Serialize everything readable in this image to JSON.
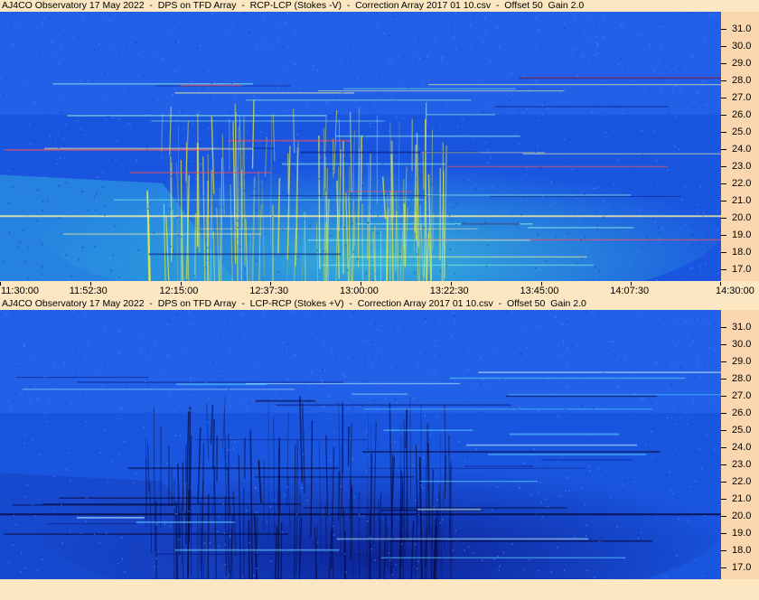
{
  "chart_data": [
    {
      "type": "heatmap",
      "title": "AJ4CO Observatory 17 May 2022  -  DPS on TFD Array  -  RCP-LCP (Stokes -V)  -  Correction Array 2017 01 10.csv  -  Offset 50  Gain 2.0",
      "y_ticks": [
        "31.0",
        "30.0",
        "29.0",
        "28.0",
        "27.0",
        "26.0",
        "25.0",
        "24.0",
        "23.0",
        "22.0",
        "21.0",
        "20.0",
        "19.0",
        "18.0",
        "17.0"
      ],
      "x_ticks": [
        "11:30:00",
        "11:52:30",
        "12:15:00",
        "12:37:30",
        "13:00:00",
        "13:22:30",
        "13:45:00",
        "14:07:30",
        "14:30:00"
      ],
      "ylim": [
        16.3,
        32.0
      ],
      "colors": {
        "background": "#1a55e0",
        "enhanced": "#3fd0d8",
        "strong": "#e8f040"
      }
    },
    {
      "type": "heatmap",
      "title": "AJ4CO Observatory 17 May 2022  -  DPS on TFD Array  -  LCP-RCP (Stokes +V)  -  Correction Array 2017 01 10.csv  -  Offset 50  Gain 2.0",
      "y_ticks": [
        "31.0",
        "30.0",
        "29.0",
        "28.0",
        "27.0",
        "26.0",
        "25.0",
        "24.0",
        "23.0",
        "22.0",
        "21.0",
        "20.0",
        "19.0",
        "18.0",
        "17.0"
      ],
      "ylim": [
        16.3,
        32.0
      ],
      "colors": {
        "background": "#1a55e0",
        "depleted": "#0a1a8a",
        "dark": "#05083a"
      }
    }
  ]
}
